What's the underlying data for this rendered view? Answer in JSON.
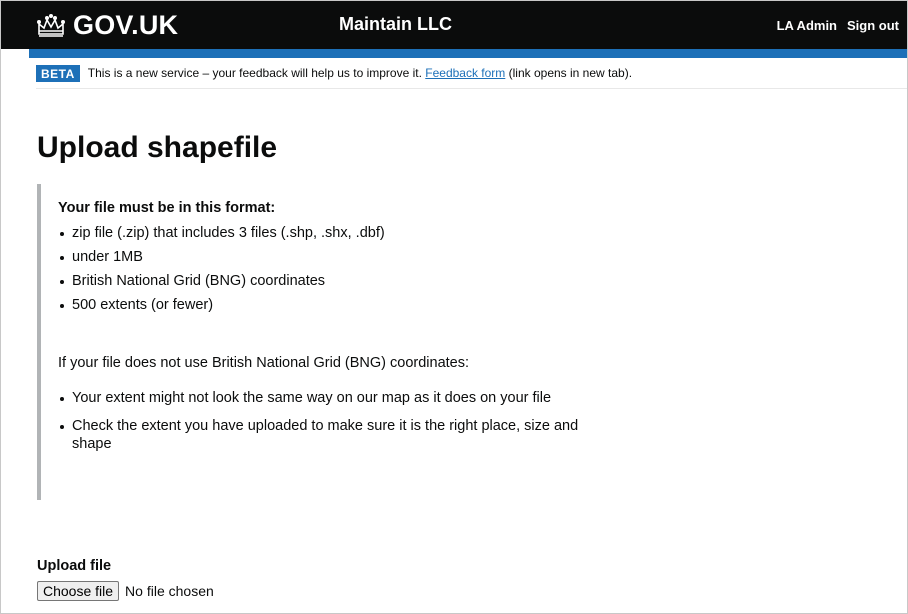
{
  "header": {
    "logo_text": "GOV.UK",
    "service_name": "Maintain LLC",
    "nav": {
      "admin_label": "LA Admin",
      "signout_label": "Sign out"
    },
    "colors": {
      "background": "#0b0c0c",
      "accent_bar": "#1d70b8"
    }
  },
  "phase_banner": {
    "tag": "BETA",
    "text_before": "This is a new service – your feedback will help us to improve it. ",
    "link_text": "Feedback form",
    "text_after": " (link opens in new tab)."
  },
  "main": {
    "title": "Upload shapefile",
    "inset": {
      "heading": "Your file must be in this format:",
      "requirements": [
        "zip file (.zip) that includes 3 files (.shp, .shx, .dbf)",
        "under 1MB",
        "British National Grid (BNG) coordinates",
        "500 extents (or fewer)"
      ],
      "paragraph": "If your file does not use British National Grid (BNG) coordinates:",
      "notes": [
        "Your extent might not look the same way on our map as it does on your file",
        "Check the extent you have uploaded to make sure it is the right place, size and shape"
      ]
    },
    "upload": {
      "label": "Upload file",
      "button_label": "Choose file",
      "status": "No file chosen"
    }
  },
  "icons": {
    "logo_icon": "crown-icon"
  }
}
